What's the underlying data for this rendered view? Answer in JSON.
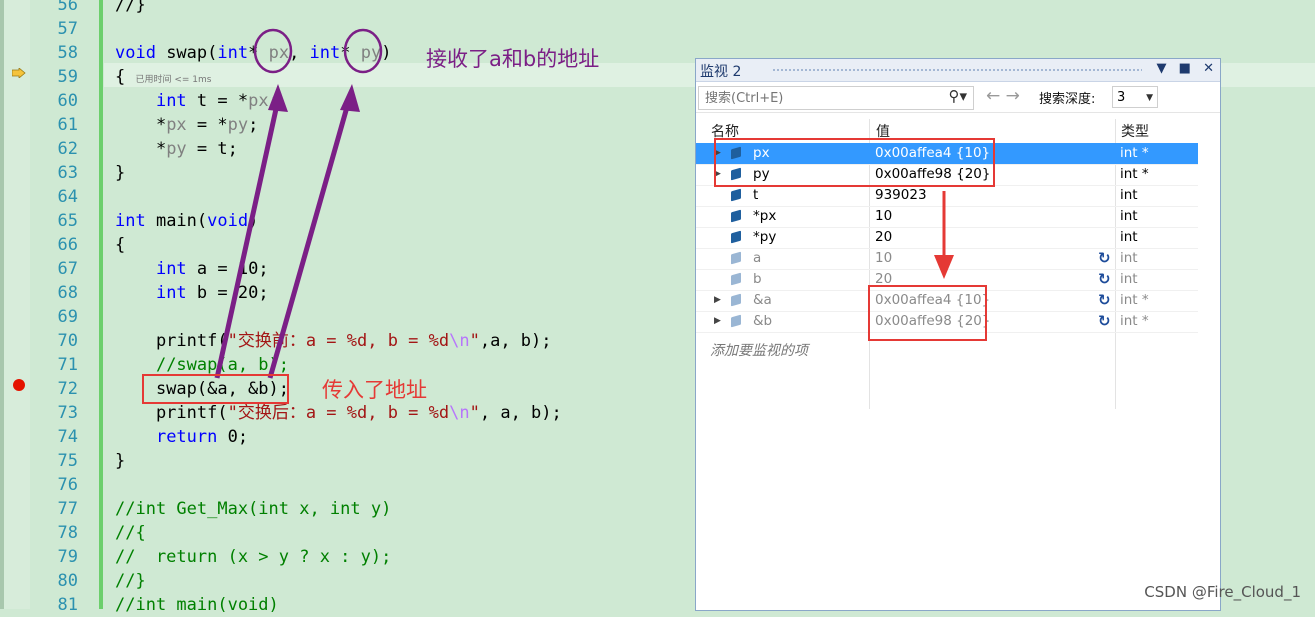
{
  "editor": {
    "lines": [
      {
        "no": "56",
        "html": "//}"
      },
      {
        "no": "57",
        "html": ""
      },
      {
        "no": "58",
        "html": "<span class='kw'>void</span> swap(<span class='kw'>int</span>* <span class='pm'>px</span>, <span class='kw'>int</span>* <span class='pm'>py</span>)"
      },
      {
        "no": "59",
        "html": "{ <span class='perf'>已用时间 &lt;= 1ms</span>"
      },
      {
        "no": "60",
        "html": "    <span class='kw'>int</span> t = *<span class='pm'>px</span>;"
      },
      {
        "no": "61",
        "html": "    *<span class='pm'>px</span> = *<span class='pm'>py</span>;"
      },
      {
        "no": "62",
        "html": "    *<span class='pm'>py</span> = t;"
      },
      {
        "no": "63",
        "html": "}"
      },
      {
        "no": "64",
        "html": ""
      },
      {
        "no": "65",
        "html": "<span class='kw'>int</span> main(<span class='kw'>void</span>)"
      },
      {
        "no": "66",
        "html": "{"
      },
      {
        "no": "67",
        "html": "    <span class='kw'>int</span> a = 10;"
      },
      {
        "no": "68",
        "html": "    <span class='kw'>int</span> b = 20;"
      },
      {
        "no": "69",
        "html": ""
      },
      {
        "no": "70",
        "html": "    printf(<span class='st'>\"交换前：a = %d, b = %d</span><span class='es'>\\n</span><span class='st'>\"</span>,a, b);"
      },
      {
        "no": "71",
        "html": "    <span class='cm'>//swap(a, b);</span>"
      },
      {
        "no": "72",
        "html": "    swap(&amp;a, &amp;b);"
      },
      {
        "no": "73",
        "html": "    printf(<span class='st'>\"交换后：a = %d, b = %d</span><span class='es'>\\n</span><span class='st'>\"</span>, a, b);"
      },
      {
        "no": "74",
        "html": "    <span class='kw'>return</span> 0;"
      },
      {
        "no": "75",
        "html": "}"
      },
      {
        "no": "76",
        "html": ""
      },
      {
        "no": "77",
        "html": "<span class='cm'>//int Get_Max(int x, int y)</span>"
      },
      {
        "no": "78",
        "html": "<span class='cm'>//{</span>"
      },
      {
        "no": "79",
        "html": "<span class='cm'>//  return (x &gt; y ? x : y);</span>"
      },
      {
        "no": "80",
        "html": "<span class='cm'>//}</span>"
      },
      {
        "no": "81",
        "html": "<span class='cm'>//int main(void)</span>"
      }
    ]
  },
  "annotations": {
    "receive": "接收了a和b的地址",
    "pass": "传入了地址"
  },
  "watch": {
    "title": "监视 2",
    "search_placeholder": "搜索(Ctrl+E)",
    "depth_label": "搜索深度:",
    "depth_value": "3",
    "headers": {
      "name": "名称",
      "value": "值",
      "type": "类型"
    },
    "rows": [
      {
        "name": "px",
        "value": "0x00affea4 {10}",
        "type": "int *",
        "expand": true,
        "selected": true,
        "grey": false,
        "refresh": false
      },
      {
        "name": "py",
        "value": "0x00affe98 {20}",
        "type": "int *",
        "expand": true,
        "selected": false,
        "grey": false,
        "refresh": false
      },
      {
        "name": "t",
        "value": "939023",
        "type": "int",
        "expand": false,
        "selected": false,
        "grey": false,
        "refresh": false
      },
      {
        "name": "*px",
        "value": "10",
        "type": "int",
        "expand": false,
        "selected": false,
        "grey": false,
        "refresh": false
      },
      {
        "name": "*py",
        "value": "20",
        "type": "int",
        "expand": false,
        "selected": false,
        "grey": false,
        "refresh": false
      },
      {
        "name": "a",
        "value": "10",
        "type": "int",
        "expand": false,
        "selected": false,
        "grey": true,
        "refresh": true
      },
      {
        "name": "b",
        "value": "20",
        "type": "int",
        "expand": false,
        "selected": false,
        "grey": true,
        "refresh": true
      },
      {
        "name": "&a",
        "value": "0x00affea4 {10}",
        "type": "int *",
        "expand": true,
        "selected": false,
        "grey": true,
        "refresh": true
      },
      {
        "name": "&b",
        "value": "0x00affe98 {20}",
        "type": "int *",
        "expand": true,
        "selected": false,
        "grey": true,
        "refresh": true
      }
    ],
    "add_item": "添加要监视的项"
  },
  "watermark": "CSDN @Fire_Cloud_1",
  "colors": {
    "editor_bg": "#cfe9d3",
    "annotation_purple": "#7b1f86",
    "annotation_red": "#e53935",
    "selection": "#3399ff"
  }
}
